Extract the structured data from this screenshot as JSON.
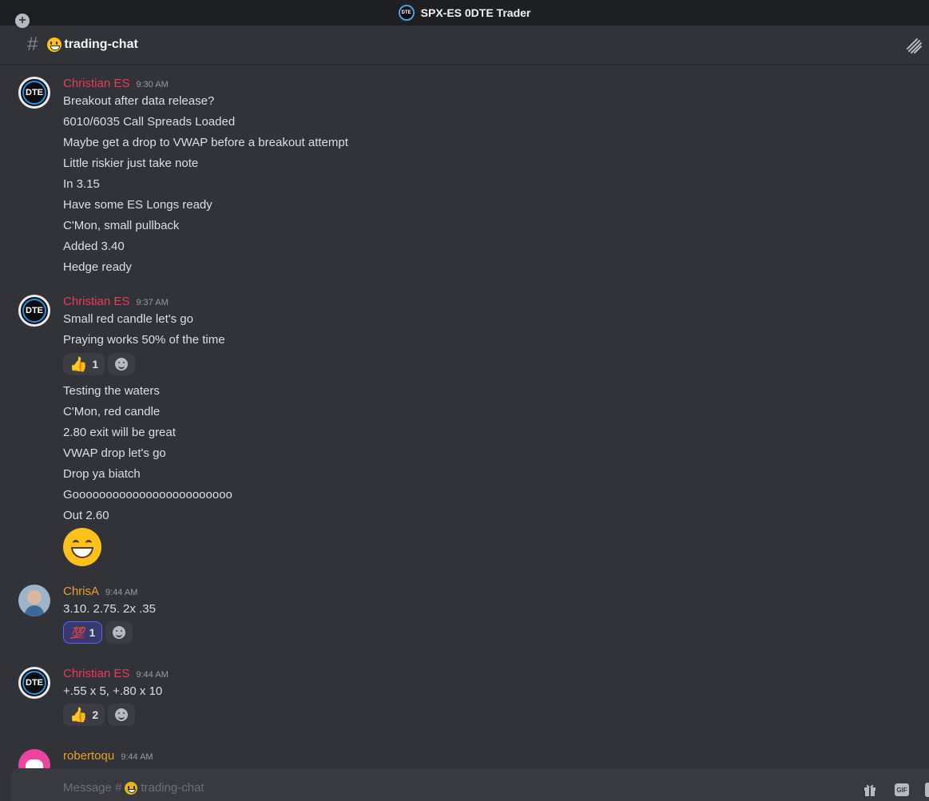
{
  "window": {
    "title": "SPX-ES 0DTE Trader",
    "logo_text": "DTE"
  },
  "channel": {
    "hash": "#",
    "name": "trading-chat",
    "emoji": "grinning-face-icon"
  },
  "messages": [
    {
      "author": "Christian ES",
      "time": "9:30 AM",
      "avatar": "DTE",
      "lines": [
        "Breakout after data release?",
        "6010/6035 Call Spreads Loaded",
        "Maybe get a drop to VWAP before a breakout attempt",
        "Little riskier just take note",
        "In 3.15",
        "Have some ES Longs ready",
        "C'Mon, small pullback",
        "Added 3.40",
        "Hedge ready"
      ]
    },
    {
      "author": "Christian ES",
      "time": "9:37 AM",
      "avatar": "DTE",
      "lines_a": [
        "Small red candle let's go",
        "Praying works 50% of the time"
      ],
      "reactions": [
        {
          "emoji": "👍",
          "count": "1"
        }
      ],
      "lines_b": [
        "Testing the waters",
        "C'Mon, red candle",
        "2.80 exit will be great",
        "VWAP drop let's go",
        "Drop ya biatch",
        "Goooooooooooooooooooooooo",
        "Out 2.60"
      ],
      "big_emoji": "grinning-face-with-smiling-eyes-icon"
    },
    {
      "author": "ChrisA",
      "time": "9:44 AM",
      "lines": [
        "3.10. 2.75. 2x .35"
      ],
      "reactions": [
        {
          "emoji": "💯",
          "count": "1"
        }
      ]
    },
    {
      "author": "Christian ES",
      "time": "9:44 AM",
      "avatar": "DTE",
      "lines": [
        "+.55 x 5,   +.80 x 10"
      ],
      "reactions": [
        {
          "emoji": "👍",
          "count": "2"
        }
      ]
    },
    {
      "author": "robertoqu",
      "time": "9:44 AM"
    }
  ],
  "composer": {
    "placeholder_prefix": "Message #",
    "placeholder_channel": "trading-chat",
    "gif_label": "GIF"
  },
  "colors": {
    "background": "#323339",
    "titlebar": "#1e1f22",
    "author_red": "#e63b5a",
    "author_orange": "#e89e2c",
    "composer": "#383a40"
  }
}
